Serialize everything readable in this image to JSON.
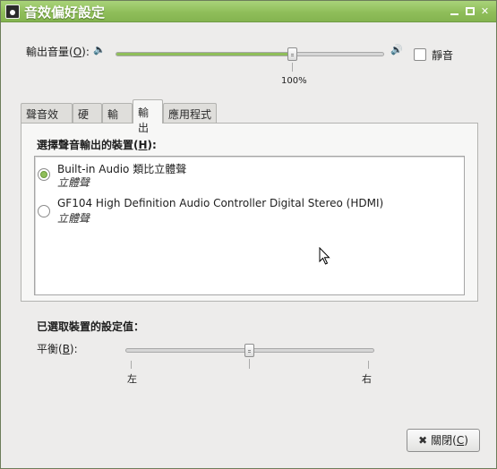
{
  "window": {
    "title": "音效偏好設定"
  },
  "volume": {
    "label_prefix": "輸出音量(",
    "label_mnemonic": "O",
    "label_suffix": "):",
    "level_percent": 100,
    "level_text": "100%",
    "mute_label": "靜音",
    "mute_checked": false
  },
  "tabs": [
    {
      "label": "聲音效果",
      "active": false
    },
    {
      "label": "硬件",
      "active": false
    },
    {
      "label": "輸入",
      "active": false
    },
    {
      "label": "輸出",
      "active": true
    },
    {
      "label": "應用程式",
      "active": false
    }
  ],
  "output": {
    "heading_prefix": "選擇聲音輸出的裝置(",
    "heading_mnemonic": "H",
    "heading_suffix": "):",
    "devices": [
      {
        "name": "Built-in Audio 類比立體聲",
        "profile": "立體聲",
        "selected": true
      },
      {
        "name": "GF104 High Definition Audio Controller Digital Stereo (HDMI)",
        "profile": "立體聲",
        "selected": false
      }
    ]
  },
  "settings": {
    "heading": "已選取裝置的設定值：",
    "balance_prefix": "平衡(",
    "balance_mnemonic": "B",
    "balance_suffix": "):",
    "balance_value": 0,
    "left_label": "左",
    "right_label": "右"
  },
  "close_button": {
    "label_prefix": "關閉(",
    "label_mnemonic": "C",
    "label_suffix": ")"
  },
  "colors": {
    "accent": "#8fbe5a",
    "titlebar": "#94c45e"
  }
}
